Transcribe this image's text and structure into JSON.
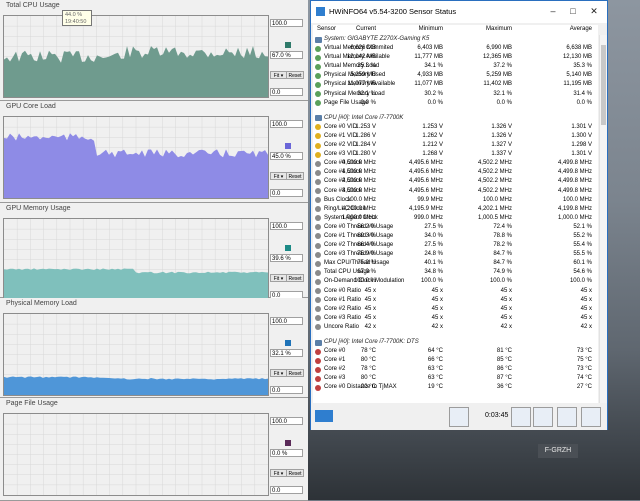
{
  "window": {
    "title": "HWiNFO64 v5.54-3200 Sensor Status",
    "columns": [
      "Sensor",
      "Current",
      "Minimum",
      "Maximum",
      "Average"
    ],
    "elapsed": "0:03:45"
  },
  "tooltip": {
    "value": "44.0 %",
    "time": "19:40:50"
  },
  "panels": [
    {
      "title": "Total CPU Usage",
      "max": "100.0",
      "current": "67.0 %",
      "min": "0.0",
      "fit_label": "Fit",
      "reset_label": "Reset",
      "color": "#6f9b8e",
      "swatch": "#2f7a6a"
    },
    {
      "title": "GPU Core Load",
      "max": "100.0",
      "current": "45.0 %",
      "min": "0.0",
      "fit_label": "Fit",
      "reset_label": "Reset",
      "color": "#8e8be6",
      "swatch": "#6a66d8"
    },
    {
      "title": "GPU Memory Usage",
      "max": "100.0",
      "current": "39.6 %",
      "min": "0.0",
      "fit_label": "Fit",
      "reset_label": "Reset",
      "color": "#7fc0bc",
      "swatch": "#1c8a86"
    },
    {
      "title": "Physical Memory Load",
      "max": "100.0",
      "current": "32.1 %",
      "min": "0.0",
      "fit_label": "Fit",
      "reset_label": "Reset",
      "color": "#4f96d8",
      "swatch": "#1f73b8"
    },
    {
      "title": "Page File Usage",
      "max": "100.0",
      "current": "0.0 %",
      "min": "0.0",
      "fit_label": "Fit",
      "reset_label": "Reset",
      "color": "#b27cc6",
      "swatch": "#5a2a58"
    }
  ],
  "rows": [
    {
      "type": "group",
      "name": "System: GIGABYTE Z270X-Gaming K5"
    },
    {
      "name": "Virtual Memory Commited",
      "cur": "6,626 MB",
      "min": "6,403 MB",
      "max": "6,990 MB",
      "avg": "6,638 MB",
      "icon": "#5aa05a"
    },
    {
      "name": "Virtual Memory Available",
      "cur": "12,142 MB",
      "min": "11,777 MB",
      "max": "12,365 MB",
      "avg": "12,130 MB",
      "icon": "#5aa05a"
    },
    {
      "name": "Virtual Memory Load",
      "cur": "35.3 %",
      "min": "34.1 %",
      "max": "37.2 %",
      "avg": "35.3 %",
      "icon": "#5aa05a"
    },
    {
      "name": "Physical Memory Used",
      "cur": "5,259 MB",
      "min": "4,933 MB",
      "max": "5,259 MB",
      "avg": "5,140 MB",
      "icon": "#5aa05a"
    },
    {
      "name": "Physical Memory Available",
      "cur": "11,077 MB",
      "min": "11,077 MB",
      "max": "11,402 MB",
      "avg": "11,195 MB",
      "icon": "#5aa05a"
    },
    {
      "name": "Physical Memory Load",
      "cur": "32.1 %",
      "min": "30.2 %",
      "max": "32.1 %",
      "avg": "31.4 %",
      "icon": "#5aa05a"
    },
    {
      "name": "Page File Usage",
      "cur": "0.0 %",
      "min": "0.0 %",
      "max": "0.0 %",
      "avg": "0.0 %",
      "icon": "#5aa05a"
    },
    {
      "type": "sep"
    },
    {
      "type": "group",
      "name": "CPU [#0]: Intel Core i7-7700K"
    },
    {
      "name": "Core #0 VID",
      "cur": "1.253 V",
      "min": "1.253 V",
      "max": "1.326 V",
      "avg": "1.301 V",
      "icon": "#e0b020"
    },
    {
      "name": "Core #1 VID",
      "cur": "1.286 V",
      "min": "1.262 V",
      "max": "1.326 V",
      "avg": "1.300 V",
      "icon": "#e0b020"
    },
    {
      "name": "Core #2 VID",
      "cur": "1.284 V",
      "min": "1.212 V",
      "max": "1.327 V",
      "avg": "1.298 V",
      "icon": "#e0b020"
    },
    {
      "name": "Core #3 VID",
      "cur": "1.280 V",
      "min": "1.268 V",
      "max": "1.337 V",
      "avg": "1.301 V",
      "icon": "#e0b020"
    },
    {
      "name": "Core #0 Clock",
      "cur": "4,500.0 MHz",
      "min": "4,495.6 MHz",
      "max": "4,502.2 MHz",
      "avg": "4,499.8 MHz",
      "icon": "#8a8a8a"
    },
    {
      "name": "Core #1 Clock",
      "cur": "4,500.0 MHz",
      "min": "4,495.6 MHz",
      "max": "4,502.2 MHz",
      "avg": "4,499.8 MHz",
      "icon": "#8a8a8a"
    },
    {
      "name": "Core #2 Clock",
      "cur": "4,500.0 MHz",
      "min": "4,495.6 MHz",
      "max": "4,502.2 MHz",
      "avg": "4,499.8 MHz",
      "icon": "#8a8a8a"
    },
    {
      "name": "Core #3 Clock",
      "cur": "4,500.0 MHz",
      "min": "4,495.6 MHz",
      "max": "4,502.2 MHz",
      "avg": "4,499.8 MHz",
      "icon": "#8a8a8a"
    },
    {
      "name": "Bus Clock",
      "cur": "100.0 MHz",
      "min": "99.9 MHz",
      "max": "100.0 MHz",
      "avg": "100.0 MHz",
      "icon": "#8a8a8a"
    },
    {
      "name": "Ring/LLC Clock",
      "cur": "4,200.0 MHz",
      "min": "4,195.9 MHz",
      "max": "4,202.1 MHz",
      "avg": "4,199.8 MHz",
      "icon": "#8a8a8a"
    },
    {
      "name": "System Agent Clock",
      "cur": "1,000.0 MHz",
      "min": "999.0 MHz",
      "max": "1,000.5 MHz",
      "avg": "1,000.0 MHz",
      "icon": "#8a8a8a"
    },
    {
      "name": "Core #0 Thread #0 Usage",
      "cur": "56.2 %",
      "min": "27.5 %",
      "max": "72.4 %",
      "avg": "52.1 %",
      "icon": "#8a8a8a"
    },
    {
      "name": "Core #1 Thread #0 Usage",
      "cur": "69.3 %",
      "min": "34.0 %",
      "max": "78.8 %",
      "avg": "55.2 %",
      "icon": "#8a8a8a"
    },
    {
      "name": "Core #2 Thread #0 Usage",
      "cur": "66.4 %",
      "min": "27.5 %",
      "max": "78.2 %",
      "avg": "55.4 %",
      "icon": "#8a8a8a"
    },
    {
      "name": "Core #3 Thread #0 Usage",
      "cur": "75.9 %",
      "min": "24.8 %",
      "max": "84.7 %",
      "avg": "55.5 %",
      "icon": "#8a8a8a"
    },
    {
      "name": "Max CPU/Thread Usage",
      "cur": "75.9 %",
      "min": "40.1 %",
      "max": "84.7 %",
      "avg": "60.1 %",
      "icon": "#8a8a8a"
    },
    {
      "name": "Total CPU Usage",
      "cur": "67.0 %",
      "min": "34.8 %",
      "max": "74.9 %",
      "avg": "54.6 %",
      "icon": "#8a8a8a"
    },
    {
      "name": "On-Demand Clock Modulation",
      "cur": "100.0 %",
      "min": "100.0 %",
      "max": "100.0 %",
      "avg": "100.0 %",
      "icon": "#8a8a8a"
    },
    {
      "name": "Core #0 Ratio",
      "cur": "45 x",
      "min": "45 x",
      "max": "45 x",
      "avg": "45 x",
      "icon": "#8a8a8a"
    },
    {
      "name": "Core #1 Ratio",
      "cur": "45 x",
      "min": "45 x",
      "max": "45 x",
      "avg": "45 x",
      "icon": "#8a8a8a"
    },
    {
      "name": "Core #2 Ratio",
      "cur": "45 x",
      "min": "45 x",
      "max": "45 x",
      "avg": "45 x",
      "icon": "#8a8a8a"
    },
    {
      "name": "Core #3 Ratio",
      "cur": "45 x",
      "min": "45 x",
      "max": "45 x",
      "avg": "45 x",
      "icon": "#8a8a8a"
    },
    {
      "name": "Uncore Ratio",
      "cur": "42 x",
      "min": "42 x",
      "max": "42 x",
      "avg": "42 x",
      "icon": "#8a8a8a"
    },
    {
      "type": "sep"
    },
    {
      "type": "group",
      "name": "CPU [#0]: Intel Core i7-7700K: DTS"
    },
    {
      "name": "Core #0",
      "cur": "78 °C",
      "min": "64 °C",
      "max": "81 °C",
      "avg": "73 °C",
      "icon": "#c04040"
    },
    {
      "name": "Core #1",
      "cur": "80 °C",
      "min": "66 °C",
      "max": "85 °C",
      "avg": "75 °C",
      "icon": "#c04040"
    },
    {
      "name": "Core #2",
      "cur": "78 °C",
      "min": "63 °C",
      "max": "86 °C",
      "avg": "73 °C",
      "icon": "#c04040"
    },
    {
      "name": "Core #3",
      "cur": "80 °C",
      "min": "63 °C",
      "max": "87 °C",
      "avg": "74 °C",
      "icon": "#c04040"
    },
    {
      "name": "Core #0 Distance to TjMAX",
      "cur": "22 °C",
      "min": "19 °C",
      "max": "36 °C",
      "avg": "27 °C",
      "icon": "#c04040"
    }
  ],
  "plane": {
    "registration": "F-GRZH"
  }
}
